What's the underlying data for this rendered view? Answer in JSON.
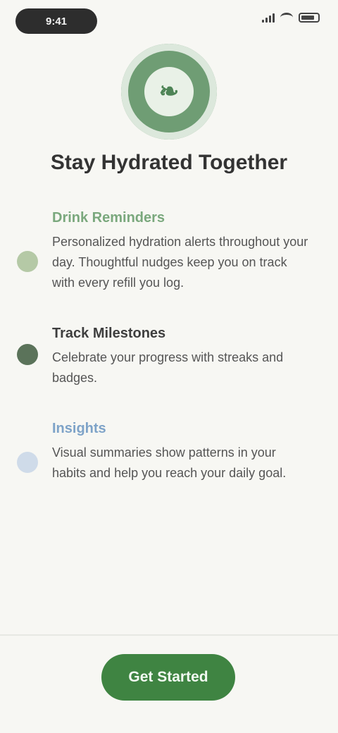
{
  "status": {
    "time": "9:41"
  },
  "screen": {
    "title": "Stay Hydrated Together",
    "hero_icon": "leaf-emblem-icon"
  },
  "features": [
    {
      "title": "Drink Reminders",
      "desc": "Personalized hydration alerts throughout your day. Thoughtful nudges keep you on track with every refill you log.",
      "dot_color": "#b5c9a6",
      "title_color": "#7aa87d"
    },
    {
      "title": "Track Milestones",
      "desc": "Celebrate your progress with streaks and badges.",
      "dot_color": "#5b735a",
      "title_color": "#3e3e3e"
    },
    {
      "title": "Insights",
      "desc": "Visual summaries show patterns in your habits and help you reach your daily goal.",
      "dot_color": "#cfdbe9",
      "title_color": "#7ea3c8"
    }
  ],
  "cta": {
    "label": "Get Started"
  }
}
